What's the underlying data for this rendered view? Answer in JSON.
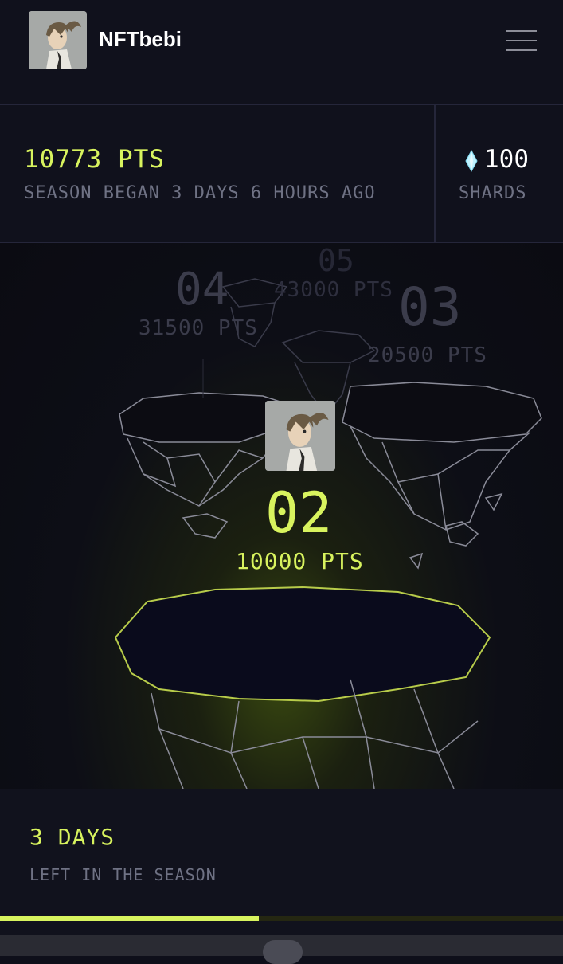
{
  "header": {
    "username": "NFTbebi",
    "menu_icon": "hamburger-menu-icon"
  },
  "stats": {
    "points": "10773 PTS",
    "season_text": "SEASON BEGAN 3 DAYS 6 HOURS AGO",
    "shards_value": "100",
    "shards_label": "SHARDS",
    "shard_icon": "diamond-shard-icon"
  },
  "levels": [
    {
      "num": "05",
      "pts": "43000 PTS"
    },
    {
      "num": "04",
      "pts": "31500 PTS"
    },
    {
      "num": "03",
      "pts": "20500 PTS"
    },
    {
      "num": "02",
      "pts": "10000 PTS"
    }
  ],
  "footer": {
    "days": "3 DAYS",
    "label": "LEFT IN THE SEASON",
    "season_progress_percent": 46
  },
  "colors": {
    "accent": "#d8f35e",
    "background": "#0e0f1a",
    "muted": "#6f7284"
  }
}
